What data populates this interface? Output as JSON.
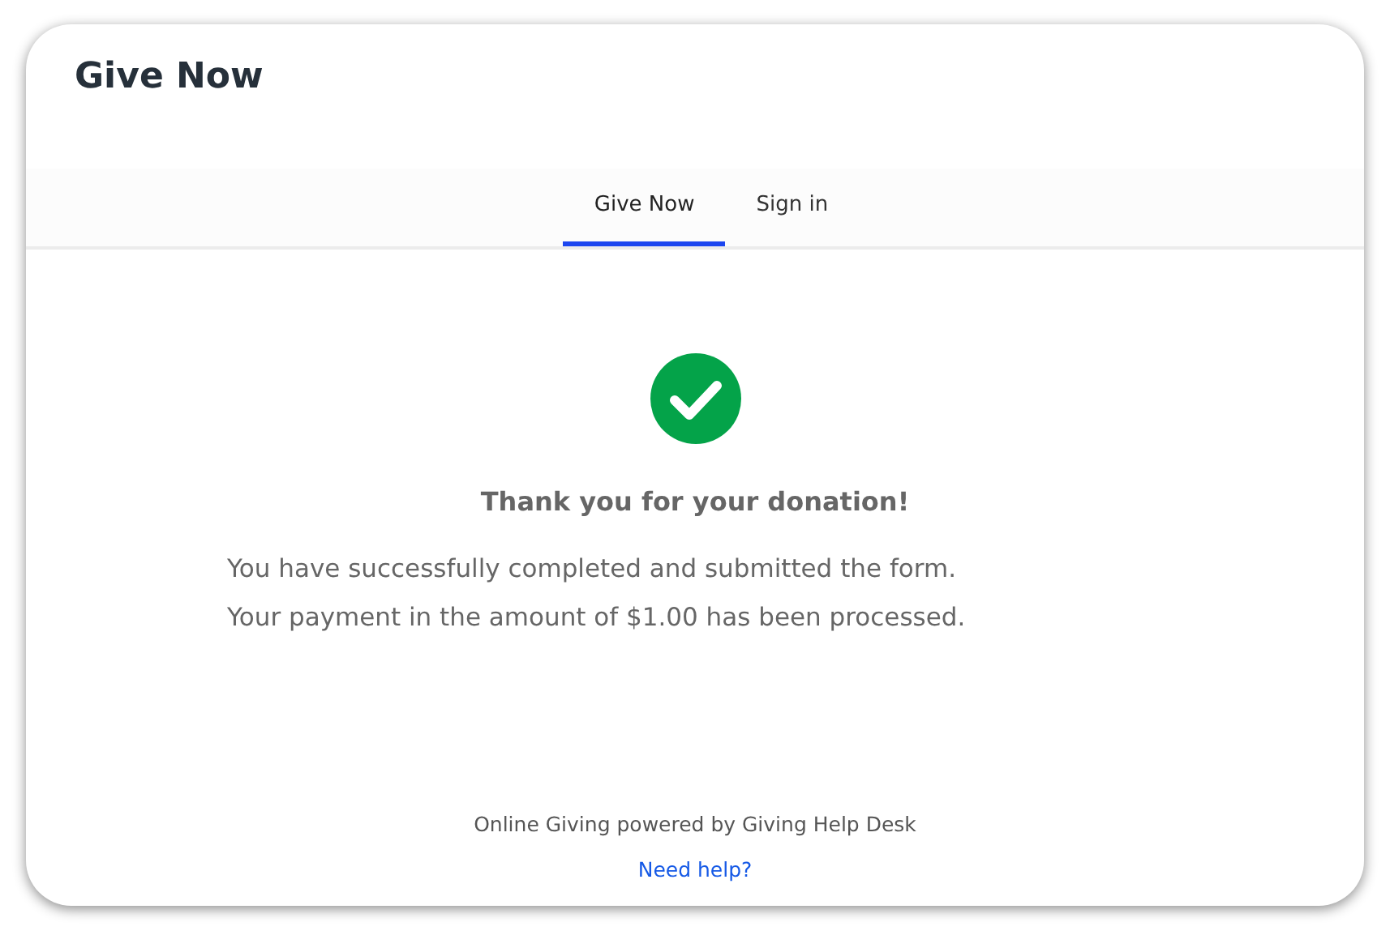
{
  "header": {
    "title": "Give Now"
  },
  "tabs": [
    {
      "label": "Give Now",
      "selected": true
    },
    {
      "label": "Sign in",
      "selected": false
    }
  ],
  "confirmation": {
    "heading": "Thank you for your donation!",
    "lines": [
      "You have successfully completed and submitted the form.",
      "Your payment in the amount of $1.00 has been processed."
    ]
  },
  "footer": {
    "text": "Online Giving powered by Giving Help Desk",
    "link": "Need help?"
  }
}
